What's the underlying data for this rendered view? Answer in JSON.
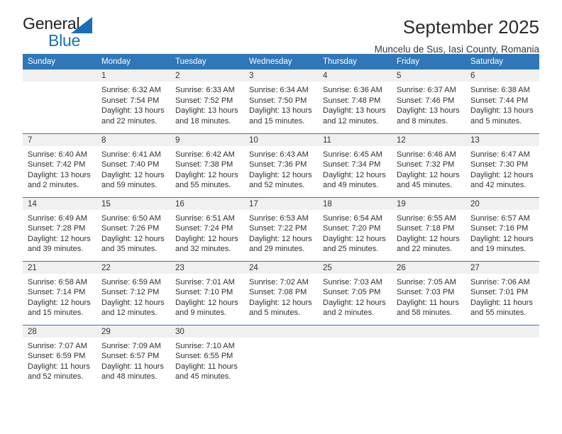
{
  "brand": {
    "name_part1": "General",
    "name_part2": "Blue",
    "triangle_color": "#1a6eb5",
    "text_color": "#231f20"
  },
  "header": {
    "title": "September 2025",
    "subtitle": "Muncelu de Sus, Iasi County, Romania",
    "accent_color": "#2f77b8"
  },
  "calendar": {
    "weekday_headers": [
      "Sunday",
      "Monday",
      "Tuesday",
      "Wednesday",
      "Thursday",
      "Friday",
      "Saturday"
    ],
    "weeks": [
      [
        {
          "day": "",
          "lines": [
            "",
            "",
            "",
            ""
          ]
        },
        {
          "day": "1",
          "lines": [
            "Sunrise: 6:32 AM",
            "Sunset: 7:54 PM",
            "Daylight: 13 hours",
            "and 22 minutes."
          ]
        },
        {
          "day": "2",
          "lines": [
            "Sunrise: 6:33 AM",
            "Sunset: 7:52 PM",
            "Daylight: 13 hours",
            "and 18 minutes."
          ]
        },
        {
          "day": "3",
          "lines": [
            "Sunrise: 6:34 AM",
            "Sunset: 7:50 PM",
            "Daylight: 13 hours",
            "and 15 minutes."
          ]
        },
        {
          "day": "4",
          "lines": [
            "Sunrise: 6:36 AM",
            "Sunset: 7:48 PM",
            "Daylight: 13 hours",
            "and 12 minutes."
          ]
        },
        {
          "day": "5",
          "lines": [
            "Sunrise: 6:37 AM",
            "Sunset: 7:46 PM",
            "Daylight: 13 hours",
            "and 8 minutes."
          ]
        },
        {
          "day": "6",
          "lines": [
            "Sunrise: 6:38 AM",
            "Sunset: 7:44 PM",
            "Daylight: 13 hours",
            "and 5 minutes."
          ]
        }
      ],
      [
        {
          "day": "7",
          "lines": [
            "Sunrise: 6:40 AM",
            "Sunset: 7:42 PM",
            "Daylight: 13 hours",
            "and 2 minutes."
          ]
        },
        {
          "day": "8",
          "lines": [
            "Sunrise: 6:41 AM",
            "Sunset: 7:40 PM",
            "Daylight: 12 hours",
            "and 59 minutes."
          ]
        },
        {
          "day": "9",
          "lines": [
            "Sunrise: 6:42 AM",
            "Sunset: 7:38 PM",
            "Daylight: 12 hours",
            "and 55 minutes."
          ]
        },
        {
          "day": "10",
          "lines": [
            "Sunrise: 6:43 AM",
            "Sunset: 7:36 PM",
            "Daylight: 12 hours",
            "and 52 minutes."
          ]
        },
        {
          "day": "11",
          "lines": [
            "Sunrise: 6:45 AM",
            "Sunset: 7:34 PM",
            "Daylight: 12 hours",
            "and 49 minutes."
          ]
        },
        {
          "day": "12",
          "lines": [
            "Sunrise: 6:46 AM",
            "Sunset: 7:32 PM",
            "Daylight: 12 hours",
            "and 45 minutes."
          ]
        },
        {
          "day": "13",
          "lines": [
            "Sunrise: 6:47 AM",
            "Sunset: 7:30 PM",
            "Daylight: 12 hours",
            "and 42 minutes."
          ]
        }
      ],
      [
        {
          "day": "14",
          "lines": [
            "Sunrise: 6:49 AM",
            "Sunset: 7:28 PM",
            "Daylight: 12 hours",
            "and 39 minutes."
          ]
        },
        {
          "day": "15",
          "lines": [
            "Sunrise: 6:50 AM",
            "Sunset: 7:26 PM",
            "Daylight: 12 hours",
            "and 35 minutes."
          ]
        },
        {
          "day": "16",
          "lines": [
            "Sunrise: 6:51 AM",
            "Sunset: 7:24 PM",
            "Daylight: 12 hours",
            "and 32 minutes."
          ]
        },
        {
          "day": "17",
          "lines": [
            "Sunrise: 6:53 AM",
            "Sunset: 7:22 PM",
            "Daylight: 12 hours",
            "and 29 minutes."
          ]
        },
        {
          "day": "18",
          "lines": [
            "Sunrise: 6:54 AM",
            "Sunset: 7:20 PM",
            "Daylight: 12 hours",
            "and 25 minutes."
          ]
        },
        {
          "day": "19",
          "lines": [
            "Sunrise: 6:55 AM",
            "Sunset: 7:18 PM",
            "Daylight: 12 hours",
            "and 22 minutes."
          ]
        },
        {
          "day": "20",
          "lines": [
            "Sunrise: 6:57 AM",
            "Sunset: 7:16 PM",
            "Daylight: 12 hours",
            "and 19 minutes."
          ]
        }
      ],
      [
        {
          "day": "21",
          "lines": [
            "Sunrise: 6:58 AM",
            "Sunset: 7:14 PM",
            "Daylight: 12 hours",
            "and 15 minutes."
          ]
        },
        {
          "day": "22",
          "lines": [
            "Sunrise: 6:59 AM",
            "Sunset: 7:12 PM",
            "Daylight: 12 hours",
            "and 12 minutes."
          ]
        },
        {
          "day": "23",
          "lines": [
            "Sunrise: 7:01 AM",
            "Sunset: 7:10 PM",
            "Daylight: 12 hours",
            "and 9 minutes."
          ]
        },
        {
          "day": "24",
          "lines": [
            "Sunrise: 7:02 AM",
            "Sunset: 7:08 PM",
            "Daylight: 12 hours",
            "and 5 minutes."
          ]
        },
        {
          "day": "25",
          "lines": [
            "Sunrise: 7:03 AM",
            "Sunset: 7:05 PM",
            "Daylight: 12 hours",
            "and 2 minutes."
          ]
        },
        {
          "day": "26",
          "lines": [
            "Sunrise: 7:05 AM",
            "Sunset: 7:03 PM",
            "Daylight: 11 hours",
            "and 58 minutes."
          ]
        },
        {
          "day": "27",
          "lines": [
            "Sunrise: 7:06 AM",
            "Sunset: 7:01 PM",
            "Daylight: 11 hours",
            "and 55 minutes."
          ]
        }
      ],
      [
        {
          "day": "28",
          "lines": [
            "Sunrise: 7:07 AM",
            "Sunset: 6:59 PM",
            "Daylight: 11 hours",
            "and 52 minutes."
          ]
        },
        {
          "day": "29",
          "lines": [
            "Sunrise: 7:09 AM",
            "Sunset: 6:57 PM",
            "Daylight: 11 hours",
            "and 48 minutes."
          ]
        },
        {
          "day": "30",
          "lines": [
            "Sunrise: 7:10 AM",
            "Sunset: 6:55 PM",
            "Daylight: 11 hours",
            "and 45 minutes."
          ]
        },
        {
          "day": "",
          "lines": [
            "",
            "",
            "",
            ""
          ]
        },
        {
          "day": "",
          "lines": [
            "",
            "",
            "",
            ""
          ]
        },
        {
          "day": "",
          "lines": [
            "",
            "",
            "",
            ""
          ]
        },
        {
          "day": "",
          "lines": [
            "",
            "",
            "",
            ""
          ]
        }
      ]
    ]
  }
}
